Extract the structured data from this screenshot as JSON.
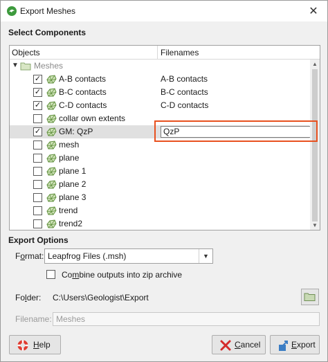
{
  "window": {
    "title": "Export Meshes",
    "close_glyph": "✕"
  },
  "select_components": {
    "heading": "Select Components",
    "columns": {
      "objects": "Objects",
      "filenames": "Filenames"
    },
    "root": {
      "label": "Meshes",
      "expander": "▼",
      "icon": "folder-icon"
    },
    "rows": [
      {
        "label": "A-B contacts",
        "checked": true,
        "filename": "A-B contacts"
      },
      {
        "label": "B-C contacts",
        "checked": true,
        "filename": "B-C contacts"
      },
      {
        "label": "C-D contacts",
        "checked": true,
        "filename": "C-D contacts"
      },
      {
        "label": "collar own extents",
        "checked": false,
        "filename": ""
      },
      {
        "label": "GM: QzP",
        "checked": true,
        "filename": "QzP",
        "selected": true,
        "editing": true
      },
      {
        "label": "mesh",
        "checked": false,
        "filename": ""
      },
      {
        "label": "plane",
        "checked": false,
        "filename": ""
      },
      {
        "label": "plane 1",
        "checked": false,
        "filename": ""
      },
      {
        "label": "plane 2",
        "checked": false,
        "filename": ""
      },
      {
        "label": "plane 3",
        "checked": false,
        "filename": ""
      },
      {
        "label": "trend",
        "checked": false,
        "filename": ""
      },
      {
        "label": "trend2",
        "checked": false,
        "filename": ""
      }
    ],
    "highlight_color": "#e8501e"
  },
  "export_options": {
    "heading": "Export Options",
    "format_label_pre": "F",
    "format_label_ul": "o",
    "format_label_post": "rmat:",
    "format_value": "Leapfrog Files (.msh)",
    "zip_label_pre": "Co",
    "zip_label_ul": "m",
    "zip_label_post": "bine outputs into zip archive",
    "zip_checked": false,
    "folder_label_pre": "Fo",
    "folder_label_ul": "l",
    "folder_label_post": "der:",
    "folder_path": "C:\\Users\\Geologist\\Export",
    "filename_label": "Filename:",
    "filename_value": "Meshes"
  },
  "buttons": {
    "help_pre": "",
    "help_ul": "H",
    "help_post": "elp",
    "cancel_pre": "",
    "cancel_ul": "C",
    "cancel_post": "ancel",
    "export_pre": "",
    "export_ul": "E",
    "export_post": "xport"
  }
}
